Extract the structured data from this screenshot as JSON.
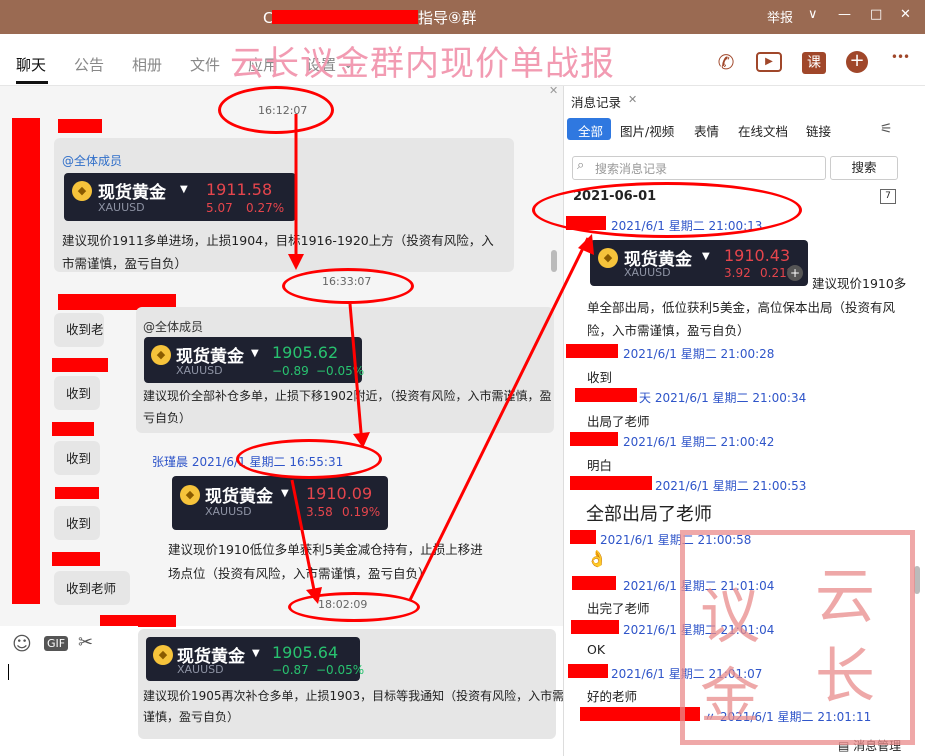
{
  "window": {
    "title_prefix": "C",
    "title_suffix": "指导⑨群",
    "report": "举报",
    "controls": {
      "dropdown": "∨",
      "minimize": "—",
      "maximize": "□",
      "close": "✕"
    }
  },
  "tabs": [
    "聊天",
    "公告",
    "相册",
    "文件",
    "应用",
    "设置"
  ],
  "tab_settings_caret": "⌄",
  "banner": "云长议金群内现价单战报",
  "toolbar_icons": {
    "phone": "✆",
    "video": "▶",
    "course": "课",
    "add": "+",
    "more": "•••"
  },
  "chat": {
    "close_mark": "✕",
    "timestamps": [
      "16:12:07",
      "16:33:07",
      "18:02:09"
    ],
    "mention": "@全体成员",
    "mention2": "@全体成员",
    "cards": [
      {
        "name": "现货黄金",
        "code": "XAUUSD",
        "price": "1911.58",
        "change": "5.07",
        "pct": "0.27%",
        "trend": "up"
      },
      {
        "name": "现货黄金",
        "code": "XAUUSD",
        "price": "1905.62",
        "change": "−0.89",
        "pct": "−0.05%",
        "trend": "down"
      },
      {
        "name": "现货黄金",
        "code": "XAUUSD",
        "price": "1910.09",
        "change": "3.58",
        "pct": "0.19%",
        "trend": "up"
      },
      {
        "name": "现货黄金",
        "code": "XAUUSD",
        "price": "1905.64",
        "change": "−0.87",
        "pct": "−0.05%",
        "trend": "down"
      }
    ],
    "msgs": {
      "m1a": "建议现价1911多单进场，止损1904，目标1916-1920上方（投资有风险，入",
      "m1b": "市需谨慎，盈亏自负）",
      "m2a": "建议现价全部补仓多单，止损下移1902附近，（投资有风险，入市需谨慎，盈",
      "m2b": "亏自负）",
      "m3a": "建议现价1910低位多单获利5美金减仓持有，止损上移进",
      "m3b": "场点位（投资有风险，入市需谨慎，盈亏自负）",
      "m4a": "建议现价1905再次补仓多单，止损1903，目标等我通知（投资有风险，入市需",
      "m4b": "谨慎，盈亏自负）"
    },
    "sender_line": "张瑾晨 2021/6/1 星期二 16:55:31",
    "left_replies": [
      "收到老",
      "收到",
      "收到",
      "收到",
      "收到老师"
    ]
  },
  "input_icons": {
    "emoji": "☺",
    "gif": "GIF",
    "scissors": "✂"
  },
  "side": {
    "title": "消息记录",
    "close": "✕",
    "filters": [
      "全部",
      "图片/视频",
      "表情",
      "在线文档",
      "链接"
    ],
    "search_placeholder": "搜索消息记录",
    "search_button": "搜索",
    "date": "2021-06-01",
    "card": {
      "name": "现货黄金",
      "code": "XAUUSD",
      "price": "1910.43",
      "change": "3.92",
      "pct": "0.21%"
    },
    "rec_card_text": "建议现价1910多",
    "rec_texts": [
      "单全部出局，低位获利5美金，高位保本出局（投资有风",
      "险，入市需谨慎，盈亏自负）"
    ],
    "records": [
      {
        "ts": "2021/6/1 星期二 21:00:13"
      },
      {
        "ts": "2021/6/1 星期二 21:00:28",
        "msg": "收到"
      },
      {
        "ts": "天 2021/6/1 星期二 21:00:34",
        "msg": "出局了老师"
      },
      {
        "ts": "2021/6/1 星期二 21:00:42",
        "msg": "明白"
      },
      {
        "ts": "2021/6/1 星期二 21:00:53",
        "msg": "全部出局了老师"
      },
      {
        "ts": "2021/6/1 星期二 21:00:58",
        "msg": "👌"
      },
      {
        "ts": "2021/6/1 星期二 21:01:04",
        "msg": "出完了老师"
      },
      {
        "ts": "2021/6/1 星期二 21:01:04",
        "msg": "OK"
      },
      {
        "ts": "2021/6/1 星期二 21:01:07",
        "msg": "好的老师"
      },
      {
        "ts": "〃 2021/6/1 星期二 21:01:11"
      }
    ],
    "manage": "消息管理"
  },
  "stamp": [
    "云",
    "长",
    "议",
    "金"
  ]
}
